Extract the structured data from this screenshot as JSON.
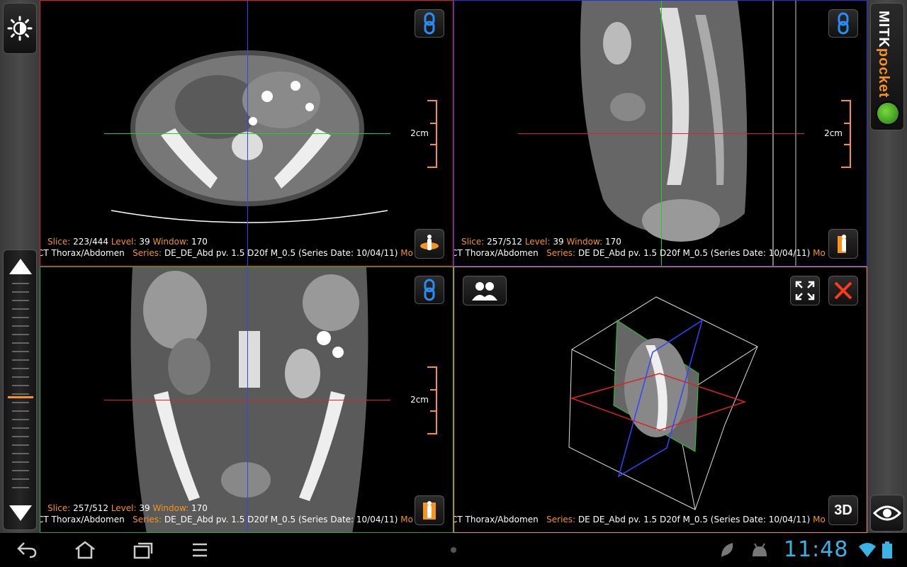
{
  "viewports": {
    "axial": {
      "slice_label": "Slice:",
      "slice_value": "223/444",
      "level_label": "Level:",
      "level_value": "39",
      "window_label": "Window:",
      "window_value": "170",
      "study": "CT Thorax/Abdomen",
      "series_label": "Series:",
      "series_value": "DE_DE_Abd pv.  1.5  D20f  M_0.5 (Series Date: 10/04/11)",
      "trail": "Mo",
      "scale_label": "2cm"
    },
    "sagittal": {
      "slice_label": "Slice:",
      "slice_value": "257/512",
      "level_label": "Level:",
      "level_value": "39",
      "window_label": "Window:",
      "window_value": "170",
      "study": "CT Thorax/Abdomen",
      "series_label": "Series:",
      "series_value": "DE  DE_Abd pv.  1.5  D20f  M_0.5 (Series Date: 10/04/11)",
      "trail": "Mo",
      "scale_label": "2cm"
    },
    "coronal": {
      "slice_label": "Slice:",
      "slice_value": "257/512",
      "level_label": "Level:",
      "level_value": "39",
      "window_label": "Window:",
      "window_value": "170",
      "study": "CT Thorax/Abdomen",
      "series_label": "Series:",
      "series_value": "DE_DE_Abd pv.  1.5  D20f  M_0.5 (Series Date: 10/04/11)",
      "trail": "Mo",
      "scale_label": "2cm"
    },
    "three_d": {
      "study": "CT Thorax/Abdomen",
      "series_label": "Series:",
      "series_value": "DE  DE_Abd pv.  1.5  D20f  M_0.5 (Series Date: 10/04/11)",
      "trail": "Mo",
      "button_3d": "3D"
    }
  },
  "logo": {
    "mitk": "MITK",
    "pocket": "pocket"
  },
  "slider": {
    "level_fraction": 0.52
  },
  "status": {
    "time": "11:48"
  },
  "colors": {
    "axial_border": "#dd2222",
    "sagittal_border": "#2233dd",
    "coronal_border": "#22aa33",
    "three_d_border": "#f7941d",
    "accent": "#f7941d",
    "clock": "#39b4e6"
  },
  "icons": [
    "brightness-icon",
    "arrow-up-icon",
    "arrow-down-icon",
    "link-icon",
    "orientation-icon",
    "twin-view-icon",
    "fullscreen-icon",
    "close-icon",
    "eye-icon",
    "back-icon",
    "home-icon",
    "recent-apps-icon",
    "menu-icon",
    "leaf-icon",
    "android-icon",
    "wifi-icon",
    "battery-icon"
  ]
}
